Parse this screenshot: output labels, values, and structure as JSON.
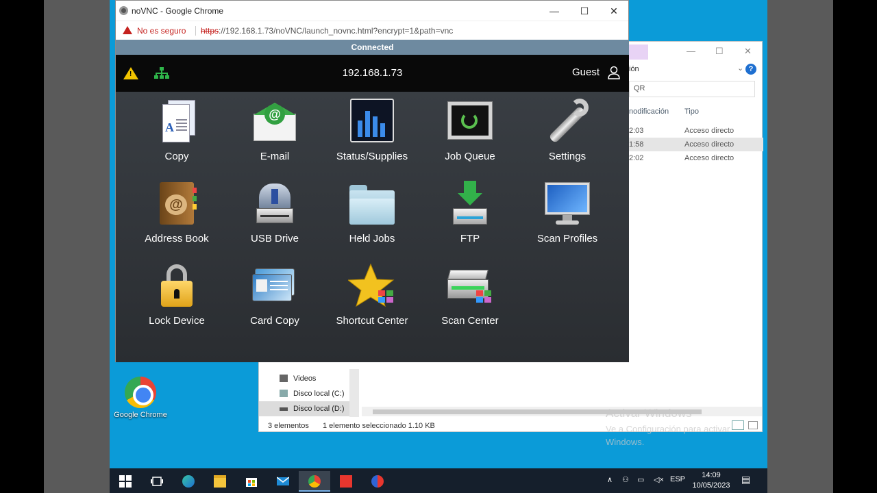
{
  "chrome": {
    "title": "noVNC - Google Chrome",
    "not_secure": "No es seguro",
    "url_scheme": "https",
    "url_rest": "://192.168.1.73/noVNC/launch_novnc.html?encrypt=1&path=vnc",
    "minimize": "—",
    "maximize": "☐",
    "close": "✕"
  },
  "vnc": {
    "status": "Connected",
    "ip": "192.168.1.73",
    "user": "Guest",
    "apps": [
      {
        "label": "Copy",
        "icon": "copy-icon"
      },
      {
        "label": "E-mail",
        "icon": "email-icon"
      },
      {
        "label": "Status/Supplies",
        "icon": "status-supplies-icon"
      },
      {
        "label": "Job Queue",
        "icon": "job-queue-icon"
      },
      {
        "label": "Settings",
        "icon": "settings-icon"
      },
      {
        "label": "Address Book",
        "icon": "address-book-icon"
      },
      {
        "label": "USB Drive",
        "icon": "usb-drive-icon"
      },
      {
        "label": "Held Jobs",
        "icon": "held-jobs-icon"
      },
      {
        "label": "FTP",
        "icon": "ftp-icon"
      },
      {
        "label": "Scan Profiles",
        "icon": "scan-profiles-icon"
      },
      {
        "label": "Lock Device",
        "icon": "lock-device-icon"
      },
      {
        "label": "Card Copy",
        "icon": "card-copy-icon"
      },
      {
        "label": "Shortcut Center",
        "icon": "shortcut-center-icon"
      },
      {
        "label": "Scan Center",
        "icon": "scan-center-icon"
      }
    ]
  },
  "explorer": {
    "ribbon_fragment": "ión",
    "search_fragment": "QR",
    "col_modified": "nodificación",
    "col_type": "Tipo",
    "rows": [
      {
        "time": "2:03",
        "type": "Acceso directo"
      },
      {
        "time": "1:58",
        "type": "Acceso directo"
      },
      {
        "time": "2:02",
        "type": "Acceso directo"
      }
    ],
    "nav": [
      "Videos",
      "Disco local (C:)",
      "Disco local (D:)"
    ],
    "status_count": "3 elementos",
    "status_selected": "1 elemento seleccionado  1.10 KB",
    "activate_title": "Activar Windows",
    "activate_sub": "Ve a Configuración para activar Windows."
  },
  "desktop": {
    "chrome_shortcut": "Google Chrome"
  },
  "taskbar": {
    "lang": "ESP",
    "time": "14:09",
    "date": "10/05/2023"
  }
}
